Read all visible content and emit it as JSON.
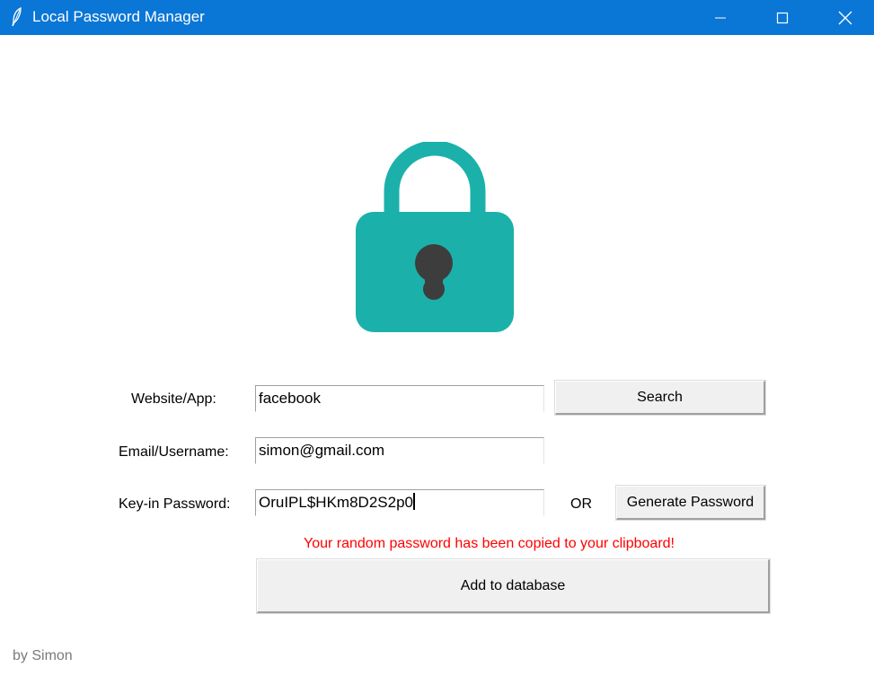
{
  "window": {
    "title": "Local Password Manager",
    "titlebar_color": "#0a76d6",
    "controls": [
      "minimize-icon",
      "maximize-icon",
      "close-icon"
    ]
  },
  "logo": {
    "icon": "padlock-icon",
    "body_color": "#1bb1aa",
    "keyhole_color": "#3d3d3d"
  },
  "form": {
    "website": {
      "label": "Website/App:",
      "value": "facebook"
    },
    "email": {
      "label": "Email/Username:",
      "value": "simon@gmail.com"
    },
    "password": {
      "label": "Key-in Password:",
      "value": "OruIPL$HKm8D2S2p0"
    },
    "or_label": "OR",
    "search_button": "Search",
    "generate_button": "Generate Password",
    "add_button": "Add to database",
    "status_message": "Your random password has been copied to your clipboard!",
    "status_color": "#ff0000"
  },
  "footer": {
    "credit": "by Simon"
  }
}
